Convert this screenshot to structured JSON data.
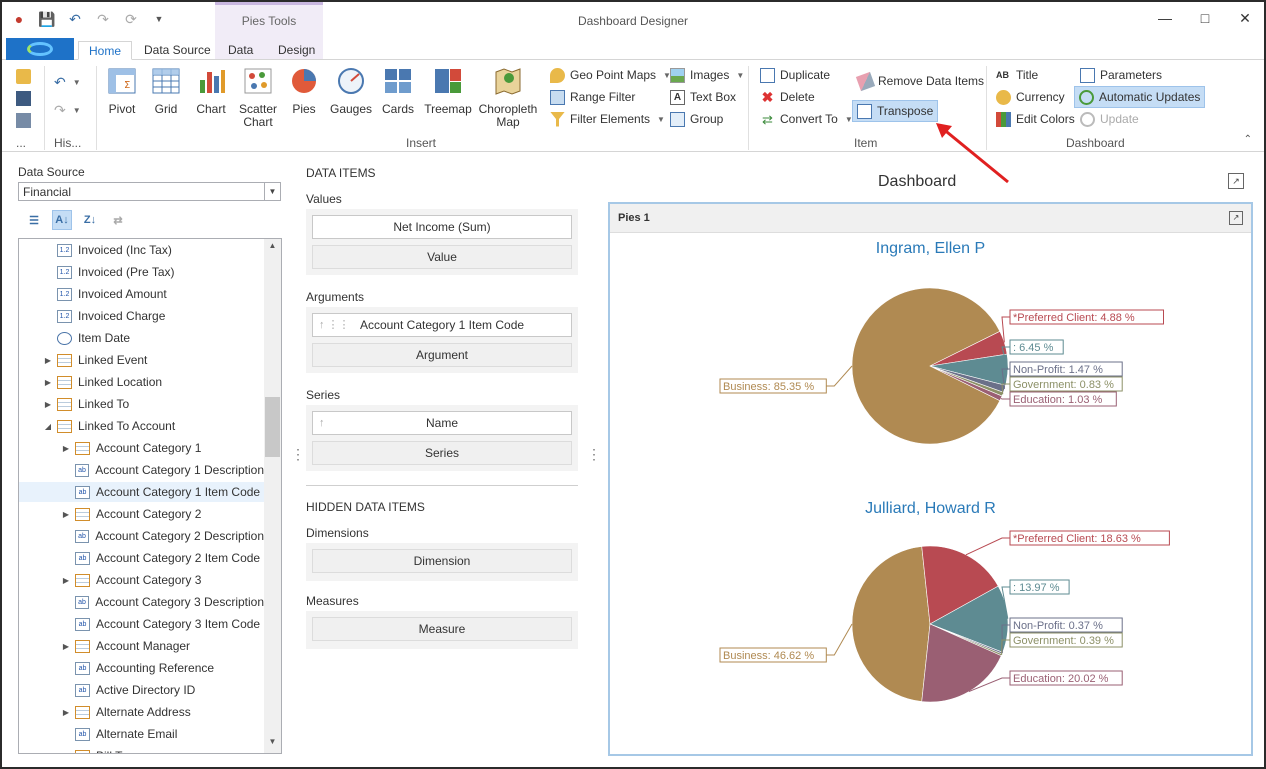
{
  "window": {
    "title": "Dashboard Designer",
    "context_tab_group": "Pies Tools"
  },
  "tabs": [
    "Home",
    "Data Source",
    "Data",
    "Design"
  ],
  "ribbon": {
    "history_label": "His...",
    "more_label": "...",
    "insert_buttons": [
      "Pivot",
      "Grid",
      "Chart",
      "Scatter Chart",
      "Pies",
      "Gauges",
      "Cards",
      "Treemap",
      "Choropleth Map"
    ],
    "insert_small": [
      "Geo Point Maps",
      "Range Filter",
      "Filter Elements",
      "Images",
      "Text Box",
      "Group"
    ],
    "insert_group_label": "Insert",
    "item_buttons": [
      "Duplicate",
      "Delete",
      "Convert To",
      "Remove Data Items",
      "Transpose"
    ],
    "item_group_label": "Item",
    "dashboard_buttons": [
      "Title",
      "Currency",
      "Edit Colors",
      "Parameters",
      "Automatic Updates",
      "Update"
    ],
    "dashboard_group_label": "Dashboard"
  },
  "datasource": {
    "label": "Data Source",
    "selected": "Financial",
    "fields": [
      {
        "label": "Invoiced (Inc Tax)",
        "type": "num",
        "indent": 0,
        "expand": false
      },
      {
        "label": "Invoiced (Pre Tax)",
        "type": "num",
        "indent": 0,
        "expand": false
      },
      {
        "label": "Invoiced Amount",
        "type": "num",
        "indent": 0,
        "expand": false
      },
      {
        "label": "Invoiced Charge",
        "type": "num",
        "indent": 0,
        "expand": false
      },
      {
        "label": "Item Date",
        "type": "date",
        "indent": 0,
        "expand": false
      },
      {
        "label": "Linked Event",
        "type": "table",
        "indent": 0,
        "expand": "collapsed"
      },
      {
        "label": "Linked Location",
        "type": "table",
        "indent": 0,
        "expand": "collapsed"
      },
      {
        "label": "Linked To",
        "type": "table",
        "indent": 0,
        "expand": "collapsed"
      },
      {
        "label": "Linked To Account",
        "type": "table",
        "indent": 0,
        "expand": "expanded"
      },
      {
        "label": "Account Category 1",
        "type": "table",
        "indent": 1,
        "expand": "collapsed"
      },
      {
        "label": "Account Category 1 Description",
        "type": "text",
        "indent": 1,
        "expand": false
      },
      {
        "label": "Account Category 1 Item Code",
        "type": "text",
        "indent": 1,
        "expand": false,
        "selected": true
      },
      {
        "label": "Account Category 2",
        "type": "table",
        "indent": 1,
        "expand": "collapsed"
      },
      {
        "label": "Account Category 2 Description",
        "type": "text",
        "indent": 1,
        "expand": false
      },
      {
        "label": "Account Category 2 Item Code",
        "type": "text",
        "indent": 1,
        "expand": false
      },
      {
        "label": "Account Category 3",
        "type": "table",
        "indent": 1,
        "expand": "collapsed"
      },
      {
        "label": "Account Category 3 Description",
        "type": "text",
        "indent": 1,
        "expand": false
      },
      {
        "label": "Account Category 3 Item Code",
        "type": "text",
        "indent": 1,
        "expand": false
      },
      {
        "label": "Account Manager",
        "type": "table",
        "indent": 1,
        "expand": "collapsed"
      },
      {
        "label": "Accounting Reference",
        "type": "text",
        "indent": 1,
        "expand": false
      },
      {
        "label": "Active Directory ID",
        "type": "text",
        "indent": 1,
        "expand": false
      },
      {
        "label": "Alternate Address",
        "type": "table",
        "indent": 1,
        "expand": "collapsed"
      },
      {
        "label": "Alternate Email",
        "type": "text",
        "indent": 1,
        "expand": false
      },
      {
        "label": "Bill To",
        "type": "table",
        "indent": 1,
        "expand": "collapsed"
      }
    ]
  },
  "data_items": {
    "heading": "DATA ITEMS",
    "values_label": "Values",
    "values_item": "Net Income (Sum)",
    "values_placeholder": "Value",
    "arguments_label": "Arguments",
    "arguments_item": "Account Category 1 Item Code",
    "arguments_placeholder": "Argument",
    "series_label": "Series",
    "series_item": "Name",
    "series_placeholder": "Series",
    "hidden_heading": "HIDDEN DATA ITEMS",
    "dimensions_label": "Dimensions",
    "dimensions_placeholder": "Dimension",
    "measures_label": "Measures",
    "measures_placeholder": "Measure"
  },
  "dashboard": {
    "title": "Dashboard",
    "item_title": "Pies 1"
  },
  "chart_data": [
    {
      "type": "pie",
      "title": "Ingram, Ellen P",
      "slices": [
        {
          "label": "Business",
          "value": 85.35,
          "color": "#b08a52"
        },
        {
          "label": "*Preferred Client",
          "value": 4.88,
          "color": "#b84a52"
        },
        {
          "label": "",
          "value": 6.45,
          "color": "#5e8b92"
        },
        {
          "label": "Non-Profit",
          "value": 1.47,
          "color": "#6b7089"
        },
        {
          "label": "Government",
          "value": 0.83,
          "color": "#8c9067"
        },
        {
          "label": "Education",
          "value": 1.03,
          "color": "#9a5f73"
        }
      ]
    },
    {
      "type": "pie",
      "title": "Julliard, Howard R",
      "slices": [
        {
          "label": "Business",
          "value": 46.62,
          "color": "#b08a52"
        },
        {
          "label": "*Preferred Client",
          "value": 18.63,
          "color": "#b84a52"
        },
        {
          "label": "",
          "value": 13.97,
          "color": "#5e8b92"
        },
        {
          "label": "Non-Profit",
          "value": 0.37,
          "color": "#6b7089"
        },
        {
          "label": "Government",
          "value": 0.39,
          "color": "#8c9067"
        },
        {
          "label": "Education",
          "value": 20.02,
          "color": "#9a5f73"
        }
      ]
    }
  ]
}
